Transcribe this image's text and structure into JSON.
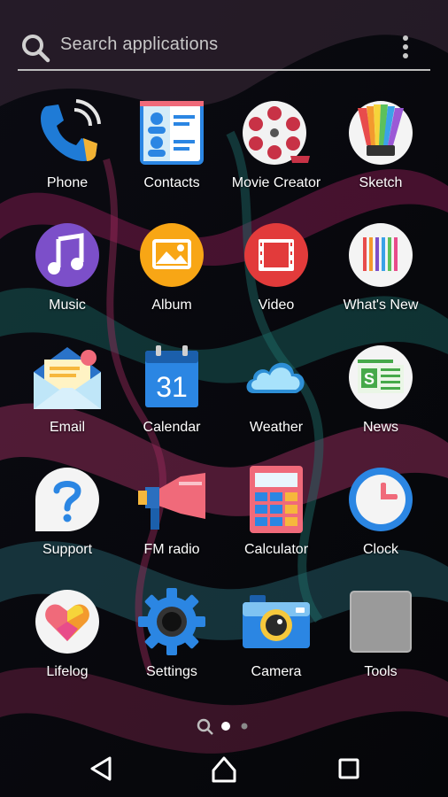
{
  "search": {
    "placeholder": "Search applications"
  },
  "apps": [
    {
      "label": "Phone",
      "icon": "phone-icon"
    },
    {
      "label": "Contacts",
      "icon": "contacts-icon"
    },
    {
      "label": "Movie Creator",
      "icon": "movie-creator-icon"
    },
    {
      "label": "Sketch",
      "icon": "sketch-icon"
    },
    {
      "label": "Music",
      "icon": "music-icon"
    },
    {
      "label": "Album",
      "icon": "album-icon"
    },
    {
      "label": "Video",
      "icon": "video-icon"
    },
    {
      "label": "What's New",
      "icon": "whats-new-icon"
    },
    {
      "label": "Email",
      "icon": "email-icon"
    },
    {
      "label": "Calendar",
      "icon": "calendar-icon"
    },
    {
      "label": "Weather",
      "icon": "weather-icon"
    },
    {
      "label": "News",
      "icon": "news-icon"
    },
    {
      "label": "Support",
      "icon": "support-icon"
    },
    {
      "label": "FM radio",
      "icon": "fm-radio-icon"
    },
    {
      "label": "Calculator",
      "icon": "calculator-icon"
    },
    {
      "label": "Clock",
      "icon": "clock-icon"
    },
    {
      "label": "Lifelog",
      "icon": "lifelog-icon"
    },
    {
      "label": "Settings",
      "icon": "settings-icon"
    },
    {
      "label": "Camera",
      "icon": "camera-icon"
    },
    {
      "label": "Tools",
      "icon": "tools-folder-icon"
    }
  ],
  "calendar_day": "31",
  "pager": {
    "current_page": 1,
    "pages": 2
  }
}
